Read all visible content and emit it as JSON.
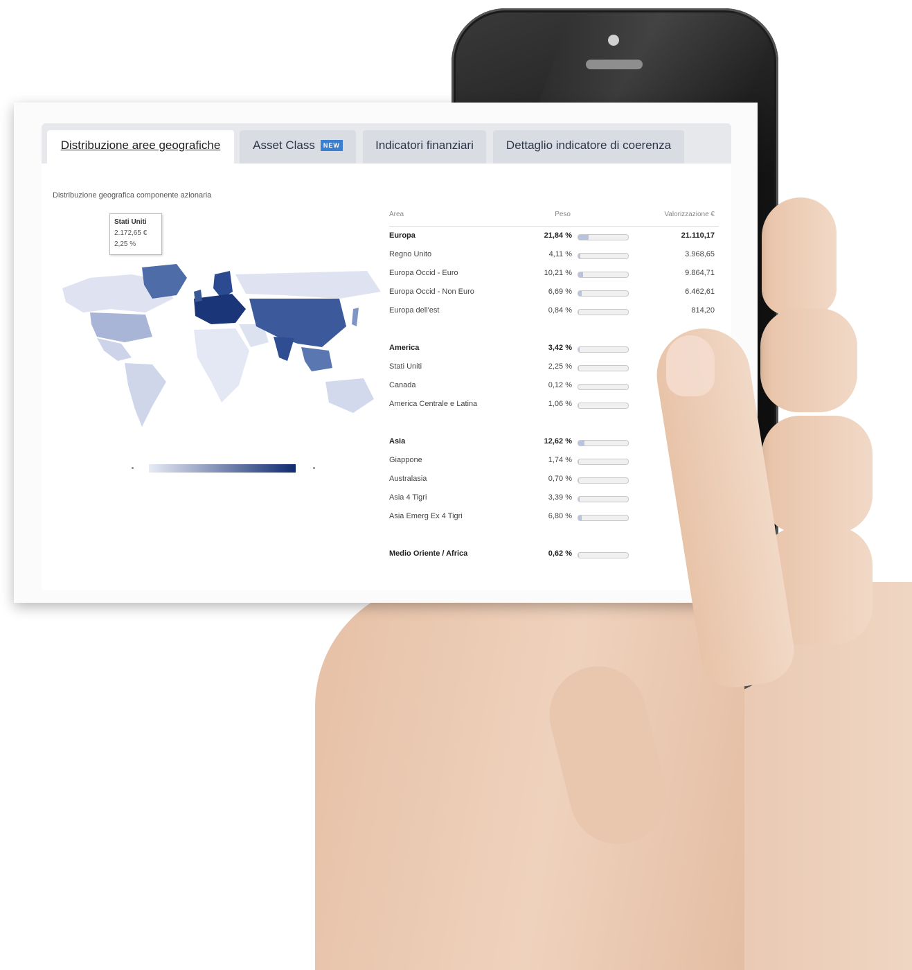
{
  "tabs": [
    {
      "label": "Distribuzione aree geografiche",
      "active": true
    },
    {
      "label": "Asset Class",
      "badge": "NEW"
    },
    {
      "label": "Indicatori finanziari"
    },
    {
      "label": "Dettaglio indicatore di coerenza"
    }
  ],
  "panel": {
    "subtitle": "Distribuzione geografica componente azionaria",
    "tooltip": {
      "title": "Stati Uniti",
      "value": "2.172,65 €",
      "weight": "2,25 %"
    }
  },
  "table": {
    "headers": {
      "area": "Area",
      "peso": "Peso",
      "valorizzazione": "Valorizzazione €"
    },
    "rows": [
      {
        "area": "Europa",
        "peso": "21,84 %",
        "val": "21.110,17",
        "group": true,
        "fill": 0.21
      },
      {
        "area": "Regno Unito",
        "peso": "4,11 %",
        "val": "3.968,65",
        "fill": 0.04
      },
      {
        "area": "Europa Occid - Euro",
        "peso": "10,21 %",
        "val": "9.864,71",
        "fill": 0.1
      },
      {
        "area": "Europa Occid - Non Euro",
        "peso": "6,69 %",
        "val": "6.462,61",
        "fill": 0.07
      },
      {
        "area": "Europa dell'est",
        "peso": "0,84 %",
        "val": "814,20",
        "fill": 0.01
      },
      {
        "gap": true
      },
      {
        "area": "America",
        "peso": "3,42 %",
        "val": "",
        "group": true,
        "fill": 0.03
      },
      {
        "area": "Stati Uniti",
        "peso": "2,25 %",
        "val": "",
        "fill": 0.02
      },
      {
        "area": "Canada",
        "peso": "0,12 %",
        "val": "",
        "fill": 0.0
      },
      {
        "area": "America Centrale e Latina",
        "peso": "1,06 %",
        "val": "",
        "fill": 0.01
      },
      {
        "gap": true
      },
      {
        "area": "Asia",
        "peso": "12,62 %",
        "val": "",
        "group": true,
        "fill": 0.12
      },
      {
        "area": "Giappone",
        "peso": "1,74 %",
        "val": "",
        "fill": 0.02
      },
      {
        "area": "Australasia",
        "peso": "0,70 %",
        "val": "",
        "fill": 0.01
      },
      {
        "area": "Asia 4 Tigri",
        "peso": "3,39 %",
        "val": "",
        "fill": 0.03
      },
      {
        "area": "Asia Emerg Ex 4 Tigri",
        "peso": "6,80 %",
        "val": "",
        "fill": 0.07
      },
      {
        "gap": true
      },
      {
        "area": "Medio Oriente / Africa",
        "peso": "0,62 %",
        "val": "",
        "group": true,
        "fill": 0.01
      }
    ]
  },
  "colors": {
    "accent": "#3b7fd0",
    "map_dark": "#0f2a6e",
    "map_light": "#e8ebf6"
  },
  "phone": {
    "menu_icon": "menu-icon",
    "home_icon": "home-icon"
  }
}
